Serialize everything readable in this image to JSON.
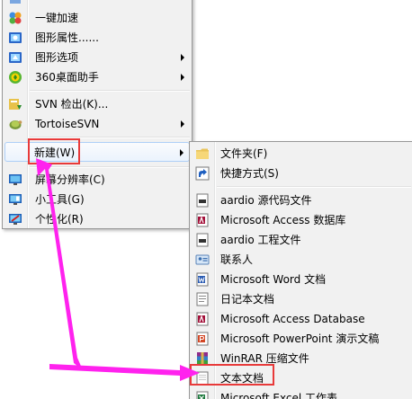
{
  "context_menu": {
    "items": [
      {
        "label": "一键加速"
      },
      {
        "label": "图形属性......"
      },
      {
        "label": "图形选项"
      },
      {
        "label": "360桌面助手"
      },
      {
        "label": "SVN 检出(K)..."
      },
      {
        "label": "TortoiseSVN"
      },
      {
        "label": "新建(W)"
      },
      {
        "label": "屏幕分辨率(C)"
      },
      {
        "label": "小工具(G)"
      },
      {
        "label": "个性化(R)"
      }
    ]
  },
  "submenu": {
    "items": [
      {
        "label": "文件夹(F)"
      },
      {
        "label": "快捷方式(S)"
      },
      {
        "label": "aardio 源代码文件"
      },
      {
        "label": "Microsoft Access 数据库"
      },
      {
        "label": "aardio 工程文件"
      },
      {
        "label": "联系人"
      },
      {
        "label": "Microsoft Word 文档"
      },
      {
        "label": "日记本文档"
      },
      {
        "label": "Microsoft Access Database"
      },
      {
        "label": "Microsoft PowerPoint 演示文稿"
      },
      {
        "label": "WinRAR 压缩文件"
      },
      {
        "label": "文本文档"
      },
      {
        "label": "Microsoft Excel 工作表"
      }
    ]
  },
  "annotation": {
    "box_color": "#e83a3a",
    "arrow_color": "#ff22ee"
  }
}
